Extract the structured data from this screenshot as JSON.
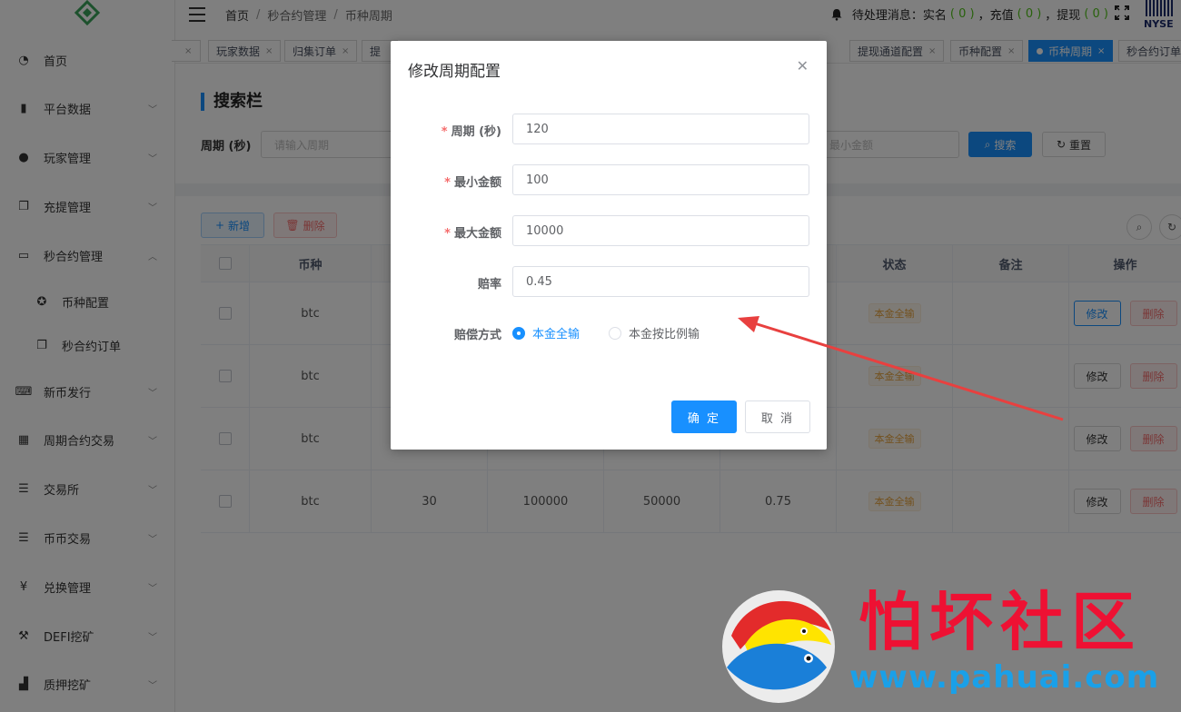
{
  "header": {
    "breadcrumb": [
      "首页",
      "秒合约管理",
      "币种周期"
    ],
    "notice_prefix": "待处理消息：实名",
    "notice_real": "( 0 )",
    "notice_mid1": "，充值",
    "notice_recharge": "( 0 )",
    "notice_mid2": "，提现",
    "notice_withdraw": "( 0 )",
    "logo_text": "NYSE"
  },
  "sidebar": {
    "items": [
      {
        "label": "首页",
        "icon": "dashboard-icon"
      },
      {
        "label": "平台数据",
        "icon": "book-icon"
      },
      {
        "label": "玩家管理",
        "icon": "user-icon"
      },
      {
        "label": "充提管理",
        "icon": "copy-icon"
      },
      {
        "label": "秒合约管理",
        "icon": "monitor-icon"
      },
      {
        "label": "币种配置",
        "icon": "gear-icon"
      },
      {
        "label": "秒合约订单",
        "icon": "copy-icon"
      },
      {
        "label": "新币发行",
        "icon": "keyboard-icon"
      },
      {
        "label": "周期合约交易",
        "icon": "table-icon"
      },
      {
        "label": "交易所",
        "icon": "list-icon"
      },
      {
        "label": "币币交易",
        "icon": "list-icon"
      },
      {
        "label": "兑换管理",
        "icon": "yen-icon"
      },
      {
        "label": "DEFI挖矿",
        "icon": "pickaxe-icon"
      },
      {
        "label": "质押挖矿",
        "icon": "bar-chart-icon"
      }
    ]
  },
  "tabs": [
    {
      "label": "玩家数据"
    },
    {
      "label": "归集订单"
    },
    {
      "label": "提"
    },
    {
      "label": "提现通道配置"
    },
    {
      "label": "币种配置"
    },
    {
      "label": "币种周期"
    },
    {
      "label": "秒合约订单"
    }
  ],
  "search": {
    "title": "搜索栏",
    "cycle_label": "周期 (秒)",
    "cycle_placeholder": "请输入周期",
    "min_placeholder": "最小金额",
    "search_btn": "搜索",
    "reset_btn": "重置"
  },
  "toolbar": {
    "add_btn": "新增",
    "delete_btn": "删除"
  },
  "table": {
    "headers": [
      "币种",
      "状态",
      "备注",
      "操作"
    ],
    "rows": [
      {
        "coin": "btc",
        "cycle": "",
        "min": "",
        "max": "",
        "rate": "",
        "status": "本金全输",
        "edit": "修改",
        "del": "删除"
      },
      {
        "coin": "btc",
        "cycle": "",
        "min": "",
        "max": "",
        "rate": "",
        "status": "本金全输",
        "edit": "修改",
        "del": "删除"
      },
      {
        "coin": "btc",
        "cycle": "",
        "min": "",
        "max": "",
        "rate": "",
        "status": "本金全输",
        "edit": "修改",
        "del": "删除"
      },
      {
        "coin": "btc",
        "cycle": "30",
        "min": "100000",
        "max": "50000",
        "rate": "0.75",
        "status": "本金全输",
        "edit": "修改",
        "del": "删除"
      }
    ]
  },
  "modal": {
    "title": "修改周期配置",
    "fields": {
      "cycle": {
        "label": "周期 (秒)",
        "value": "120"
      },
      "min": {
        "label": "最小金额",
        "value": "100"
      },
      "max": {
        "label": "最大金额",
        "value": "10000"
      },
      "rate": {
        "label": "赔率",
        "value": "0.45"
      }
    },
    "comp_label": "赔偿方式",
    "options": [
      "本金全输",
      "本金按比例输"
    ],
    "selected_option": "本金全输",
    "ok": "确 定",
    "cancel": "取 消"
  },
  "watermark": {
    "text": "怕坏社区",
    "url": "www.pahuai.com"
  },
  "colors": {
    "primary": "#1890ff",
    "danger": "#f56c6c",
    "warning": "#e6a23c",
    "annotation": "#e8403f"
  }
}
